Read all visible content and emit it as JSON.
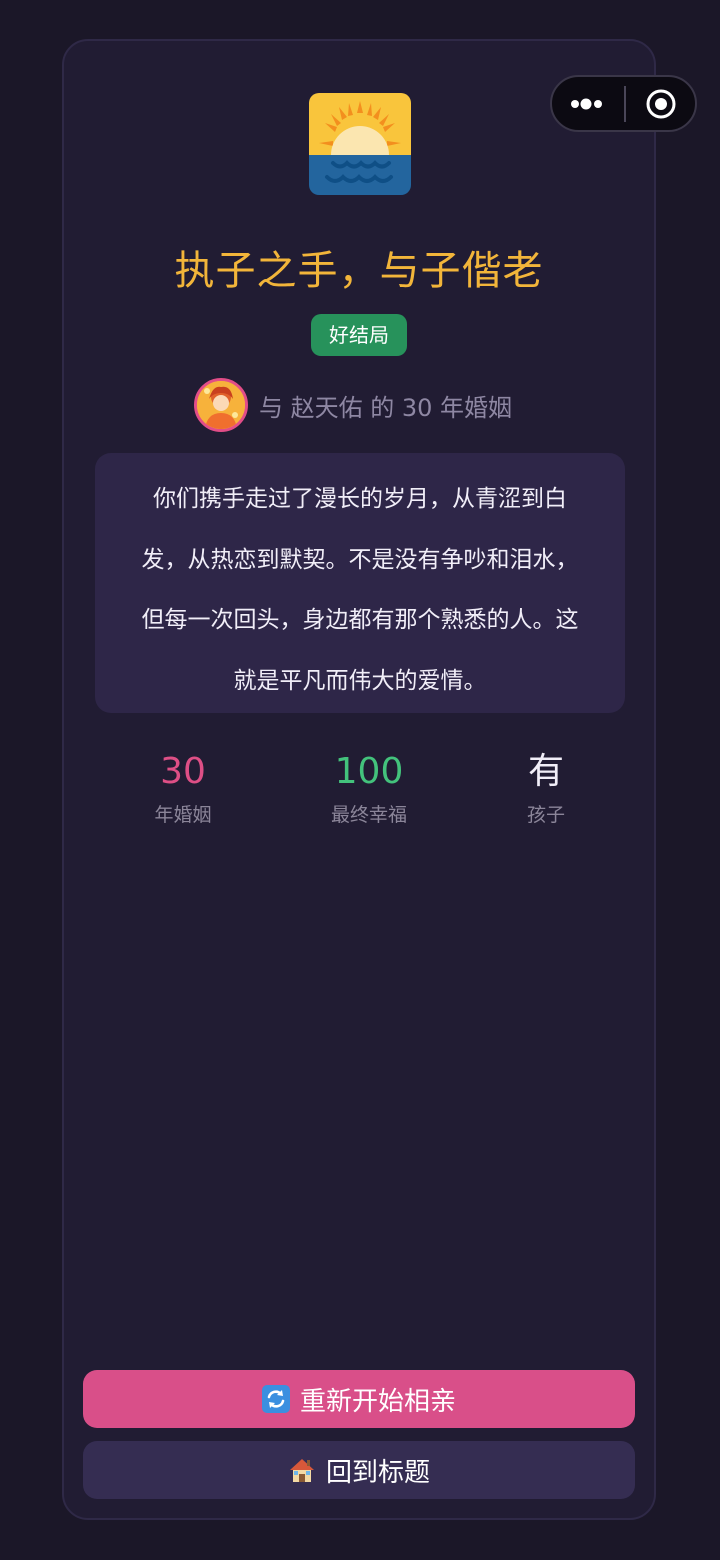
{
  "ending": {
    "icon": "sunrise-over-sea-icon",
    "title": "执子之手，与子偕老",
    "badge": "好结局",
    "partner_text": "与 赵天佑 的 30 年婚姻",
    "story": "你们携手走过了漫长的岁月，从青涩到白发，从热恋到默契。不是没有争吵和泪水，但每一次回头，身边都有那个熟悉的人。这就是平凡而伟大的爱情。"
  },
  "stats": [
    {
      "value": "30",
      "label": "年婚姻",
      "color": "#de4f86"
    },
    {
      "value": "100",
      "label": "最终幸福",
      "color": "#43c27c"
    },
    {
      "value": "有",
      "label": "孩子",
      "color": "#f1eef8"
    }
  ],
  "buttons": {
    "restart": {
      "icon": "refresh-icon",
      "label": "重新开始相亲"
    },
    "back_to_title": {
      "icon": "house-icon",
      "label": "回到标题"
    }
  },
  "capsule": {
    "more": "more-dots-icon",
    "close": "target-close-icon"
  },
  "colors": {
    "background": "#1b1728",
    "card": "#211c33",
    "title": "#f2b53a",
    "badge": "#27925b",
    "accent": "#d94f89"
  }
}
